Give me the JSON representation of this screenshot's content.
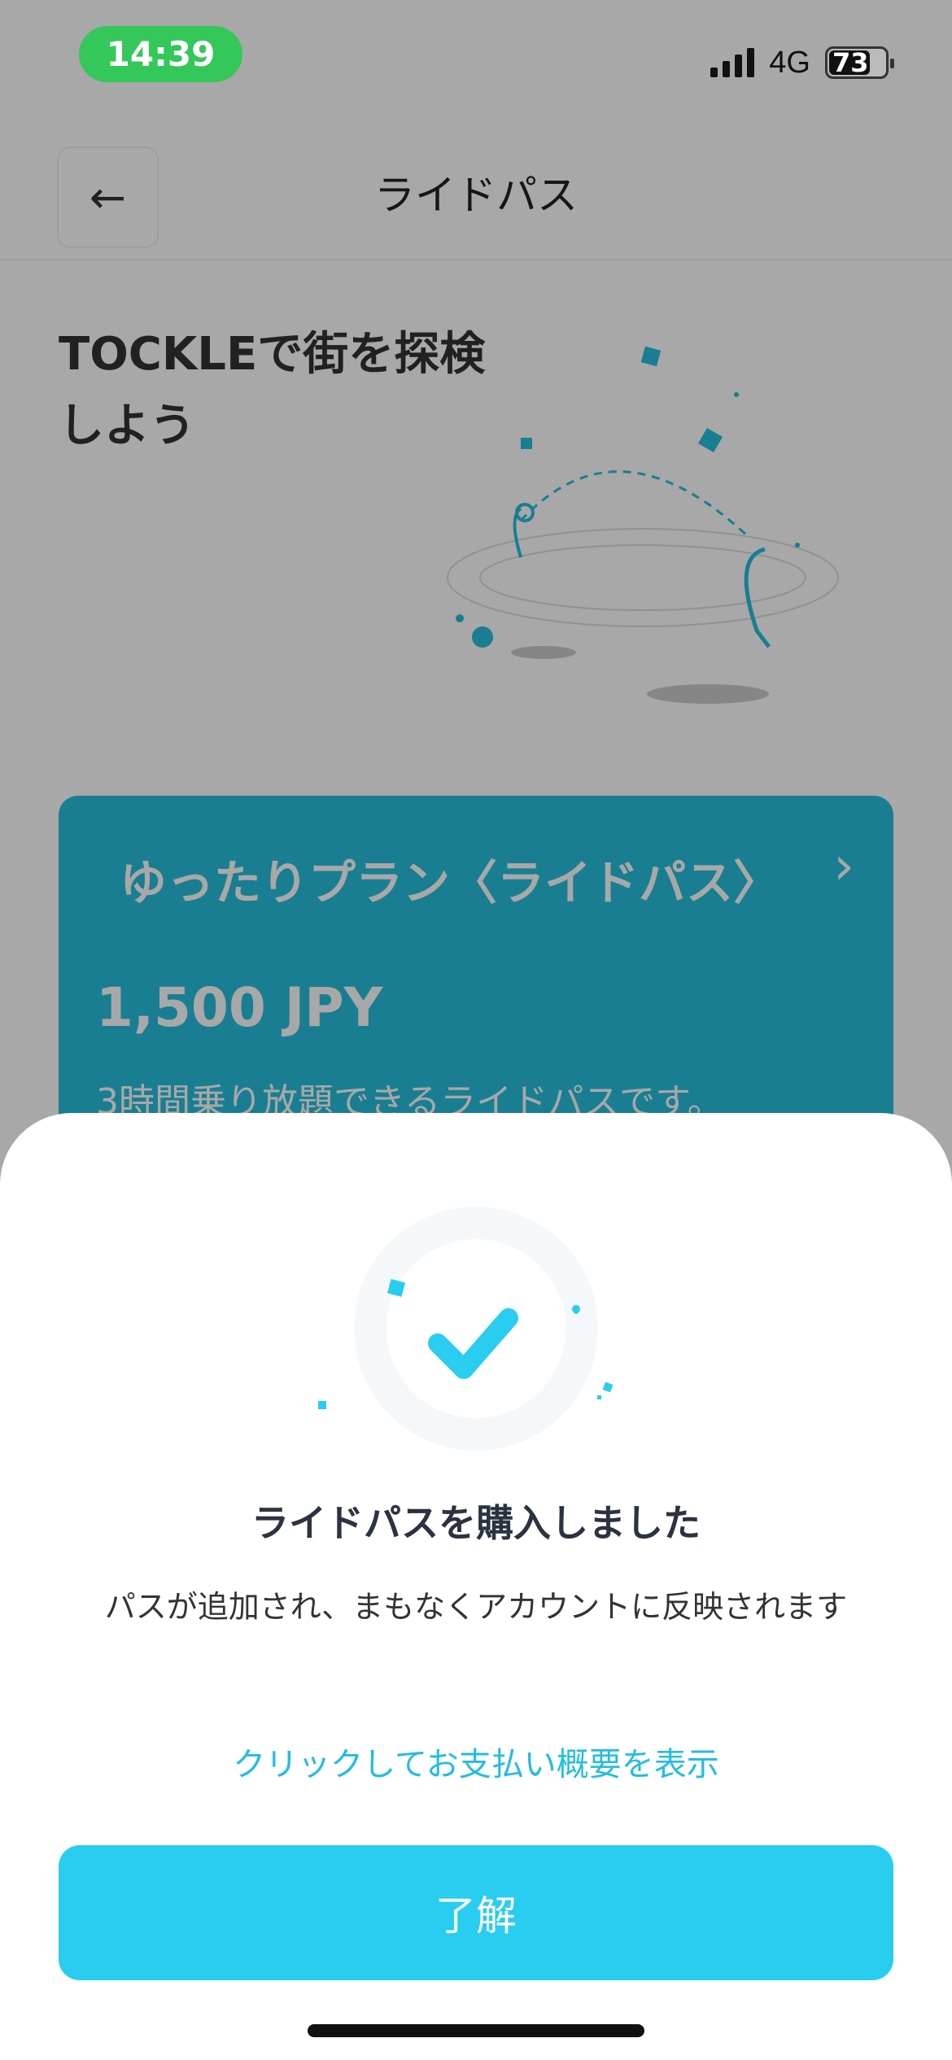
{
  "status_bar": {
    "time": "14:39",
    "network": "4G",
    "battery": "73"
  },
  "header": {
    "title": "ライドパス"
  },
  "hero": {
    "title": "TOCKLEで街を探検しよう"
  },
  "plan": {
    "name": "ゆったりプラン〈ライドパス〉",
    "price": "1,500 JPY",
    "description": "3時間乗り放題できるライドパスです。"
  },
  "sheet": {
    "title": "ライドパスを購入しました",
    "subtitle": "パスが追加され、まもなくアカウントに反映されます",
    "summary_link": "クリックしてお支払い概要を表示",
    "ok_label": "了解"
  },
  "colors": {
    "accent": "#28cdf0",
    "link": "#24bde0",
    "status_green": "#34c759"
  },
  "icons": {
    "back": "arrow-left-icon",
    "chevron": "chevron-right-icon",
    "success": "checkmark-icon"
  }
}
